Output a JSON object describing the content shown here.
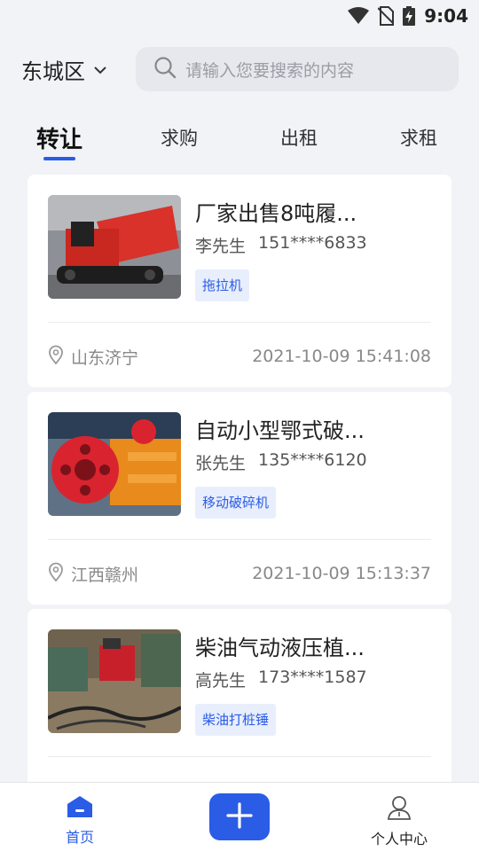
{
  "status_bar": {
    "time": "9:04",
    "icons": [
      "wifi-icon",
      "no-sim-icon",
      "battery-charging-icon"
    ]
  },
  "header": {
    "district": "东城区",
    "search_placeholder": "请输入您要搜索的内容"
  },
  "tabs": [
    {
      "label": "转让",
      "active": true
    },
    {
      "label": "求购",
      "active": false
    },
    {
      "label": "出租",
      "active": false
    },
    {
      "label": "求租",
      "active": false
    }
  ],
  "listings": [
    {
      "title": "厂家出售8吨履...",
      "contact_name": "李先生",
      "phone": "151****6833",
      "tag": "拖拉机",
      "location": "山东济宁",
      "time": "2021-10-09 15:41:08"
    },
    {
      "title": "自动小型鄂式破...",
      "contact_name": "张先生",
      "phone": "135****6120",
      "tag": "移动破碎机",
      "location": "江西赣州",
      "time": "2021-10-09 15:13:37"
    },
    {
      "title": "柴油气动液压植...",
      "contact_name": "高先生",
      "phone": "173****1587",
      "tag": "柴油打桩锤",
      "location": "",
      "time": ""
    }
  ],
  "bottom_nav": {
    "home_label": "首页",
    "add_icon": "plus-icon",
    "profile_label": "个人中心"
  },
  "colors": {
    "accent": "#2a5ce6",
    "background": "#f2f3f7",
    "tag_bg": "#e8eefc"
  }
}
